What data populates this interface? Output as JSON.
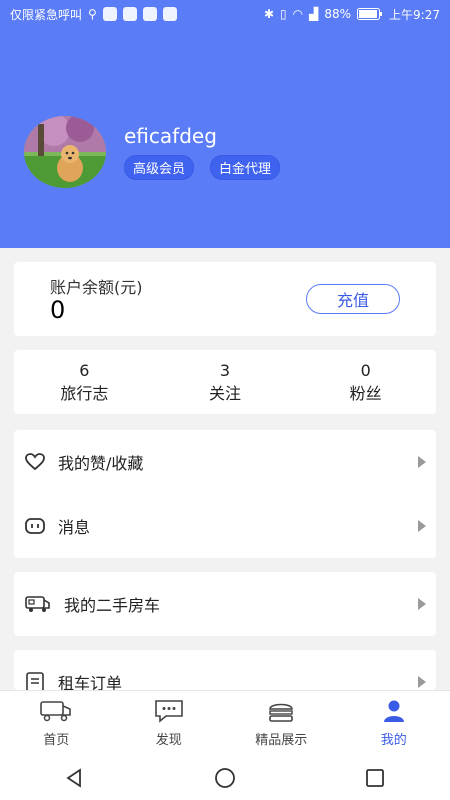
{
  "status_bar": {
    "carrier": "仅限紧急呼叫",
    "battery": "88%",
    "time": "上午9:27"
  },
  "profile": {
    "username": "eficafdeg",
    "badges": [
      "高级会员",
      "白金代理"
    ]
  },
  "balance": {
    "label": "账户余额(元)",
    "value": "0",
    "recharge_label": "充值"
  },
  "stats": [
    {
      "num": "6",
      "label": "旅行志"
    },
    {
      "num": "3",
      "label": "关注"
    },
    {
      "num": "0",
      "label": "粉丝"
    }
  ],
  "menu": {
    "likes": "我的赞/收藏",
    "messages": "消息",
    "used_rv": "我的二手房车",
    "rental_orders": "租车订单"
  },
  "tabs": [
    {
      "label": "首页",
      "icon": "rv-icon"
    },
    {
      "label": "发现",
      "icon": "chat-icon"
    },
    {
      "label": "精品展示",
      "icon": "burger-icon"
    },
    {
      "label": "我的",
      "icon": "user-icon"
    }
  ],
  "colors": {
    "primary": "#5b7cf7",
    "accent": "#3a5be6"
  }
}
